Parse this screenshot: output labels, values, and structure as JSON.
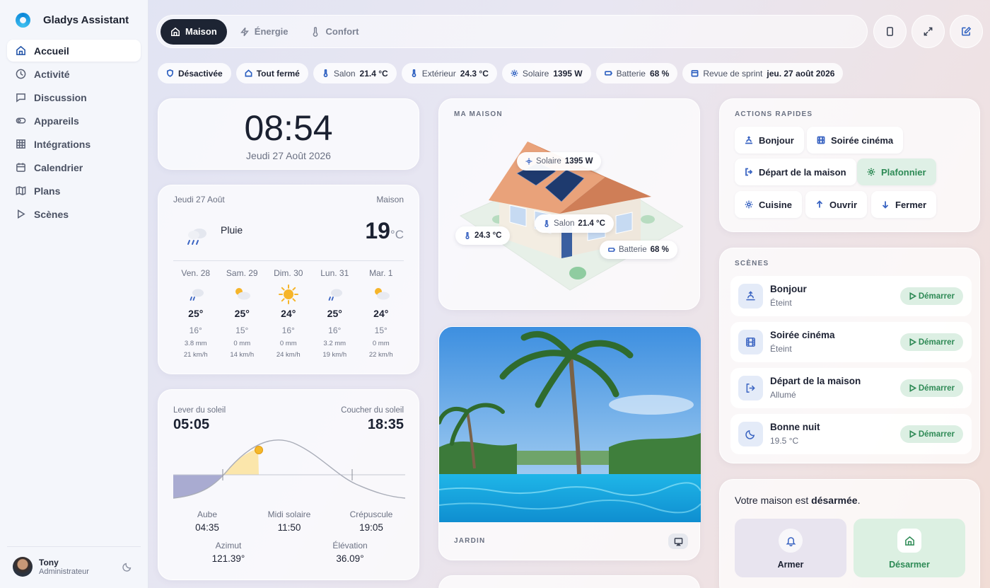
{
  "app": {
    "name": "Gladys Assistant"
  },
  "sidebar": {
    "items": [
      {
        "label": "Accueil",
        "icon": "home-icon"
      },
      {
        "label": "Activité",
        "icon": "clock-icon"
      },
      {
        "label": "Discussion",
        "icon": "chat-icon"
      },
      {
        "label": "Appareils",
        "icon": "toggle-icon"
      },
      {
        "label": "Intégrations",
        "icon": "grid-icon"
      },
      {
        "label": "Calendrier",
        "icon": "calendar-icon"
      },
      {
        "label": "Plans",
        "icon": "map-icon"
      },
      {
        "label": "Scènes",
        "icon": "play-icon"
      }
    ],
    "user": {
      "name": "Tony",
      "role": "Administrateur"
    }
  },
  "tabs": [
    {
      "label": "Maison",
      "active": true
    },
    {
      "label": "Énergie",
      "active": false
    },
    {
      "label": "Confort",
      "active": false
    }
  ],
  "chips": {
    "alarm": "Désactivée",
    "shutters": "Tout fermé",
    "salon_label": "Salon",
    "salon_value": "21.4 °C",
    "ext_label": "Extérieur",
    "ext_value": "24.3 °C",
    "solar_label": "Solaire",
    "solar_value": "1395 W",
    "battery_label": "Batterie",
    "battery_value": "68 %",
    "event_label": "Revue de sprint",
    "event_value": "jeu. 27 août 2026"
  },
  "clock": {
    "time": "08:54",
    "date": "Jeudi 27 Août 2026"
  },
  "weather": {
    "date": "Jeudi 27 Août",
    "location": "Maison",
    "condition": "Pluie",
    "temp": "19",
    "unit": "°C",
    "forecast": [
      {
        "day": "Ven. 28",
        "icon": "rain-icon",
        "hi": "25°",
        "lo": "16°",
        "rain": "3.8 mm",
        "wind": "21 km/h"
      },
      {
        "day": "Sam. 29",
        "icon": "partly-cloudy-icon",
        "hi": "25°",
        "lo": "15°",
        "rain": "0 mm",
        "wind": "14 km/h"
      },
      {
        "day": "Dim. 30",
        "icon": "sun-icon",
        "hi": "24°",
        "lo": "16°",
        "rain": "0 mm",
        "wind": "24 km/h"
      },
      {
        "day": "Lun. 31",
        "icon": "rain-icon",
        "hi": "25°",
        "lo": "16°",
        "rain": "3.2 mm",
        "wind": "19 km/h"
      },
      {
        "day": "Mar. 1",
        "icon": "partly-cloudy-icon",
        "hi": "24°",
        "lo": "15°",
        "rain": "0 mm",
        "wind": "22 km/h"
      }
    ]
  },
  "sun": {
    "sunrise_label": "Lever du soleil",
    "sunrise": "05:05",
    "sunset_label": "Coucher du soleil",
    "sunset": "18:35",
    "dawn_label": "Aube",
    "dawn": "04:35",
    "noon_label": "Midi solaire",
    "noon": "11:50",
    "dusk_label": "Crépuscule",
    "dusk": "19:05",
    "azimuth_label": "Azimut",
    "azimuth": "121.39°",
    "elevation_label": "Élévation",
    "elevation": "36.09°"
  },
  "house": {
    "title": "Ma maison",
    "solar_label": "Solaire",
    "solar_value": "1395 W",
    "ext_value": "24.3 °C",
    "salon_label": "Salon",
    "salon_value": "21.4 °C",
    "battery_label": "Batterie",
    "battery_value": "68 %"
  },
  "garden": {
    "title": "Jardin"
  },
  "quick_actions": {
    "title": "Actions rapides",
    "items": [
      {
        "label": "Bonjour",
        "icon": "sunrise-icon"
      },
      {
        "label": "Soirée cinéma",
        "icon": "film-icon"
      },
      {
        "label": "Départ de la maison",
        "icon": "logout-icon"
      },
      {
        "label": "Plafonnier",
        "icon": "sun-icon",
        "active": true
      },
      {
        "label": "Cuisine",
        "icon": "sun-icon"
      },
      {
        "label": "Ouvrir",
        "icon": "arrow-up-icon"
      },
      {
        "label": "Fermer",
        "icon": "arrow-down-icon"
      }
    ]
  },
  "scenes": {
    "title": "Scènes",
    "start_label": "Démarrer",
    "items": [
      {
        "name": "Bonjour",
        "state": "Éteint",
        "icon": "sunrise-icon"
      },
      {
        "name": "Soirée cinéma",
        "state": "Éteint",
        "icon": "film-icon"
      },
      {
        "name": "Départ de la maison",
        "state": "Allumé",
        "icon": "logout-icon"
      },
      {
        "name": "Bonne nuit",
        "state": "19.5 °C",
        "icon": "moon-icon"
      }
    ]
  },
  "alarm": {
    "text_prefix": "Votre maison est ",
    "text_state": "désarmée",
    "text_suffix": ".",
    "arm_label": "Armer",
    "disarm_label": "Désarmer"
  },
  "colors": {
    "accent": "#1d2433",
    "primary": "#2c5fc0",
    "success": "#2d8a55"
  }
}
